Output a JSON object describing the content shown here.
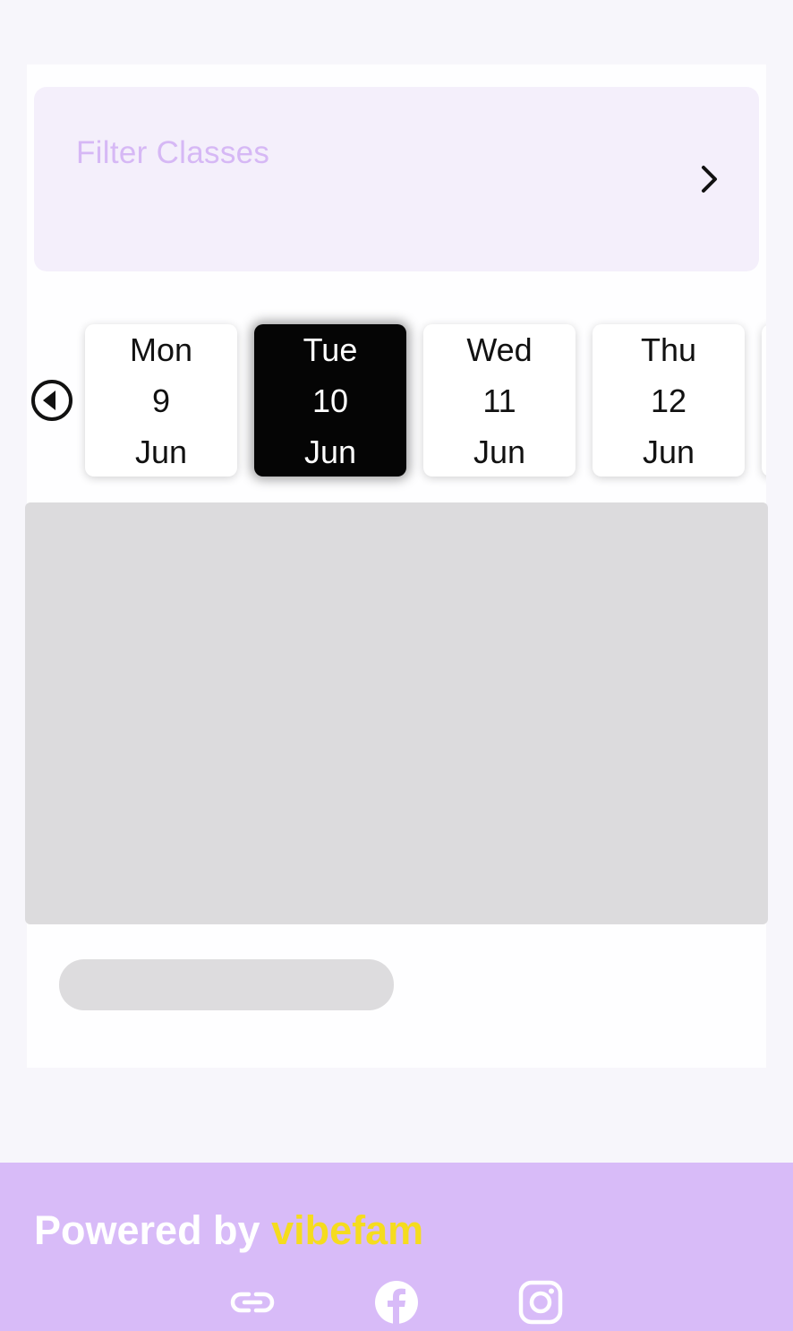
{
  "filter": {
    "placeholder": "Filter Classes",
    "icon": "chevron-right-icon"
  },
  "date_strip": {
    "prev_icon": "circle-arrow-left-icon",
    "days": [
      {
        "weekday": "Mon",
        "day": "9",
        "month": "Jun",
        "selected": false
      },
      {
        "weekday": "Tue",
        "day": "10",
        "month": "Jun",
        "selected": true
      },
      {
        "weekday": "Wed",
        "day": "11",
        "month": "Jun",
        "selected": false
      },
      {
        "weekday": "Thu",
        "day": "12",
        "month": "Jun",
        "selected": false
      }
    ]
  },
  "footer": {
    "powered_by": "Powered by ",
    "brand": "vibefam",
    "social_icons": [
      "link-icon",
      "facebook-icon",
      "instagram-icon"
    ]
  },
  "colors": {
    "accent": "#d8bbf8",
    "brand_yellow": "#f5dc1e",
    "filter_text": "#d6b8f5",
    "selected_day_bg": "#050505"
  }
}
